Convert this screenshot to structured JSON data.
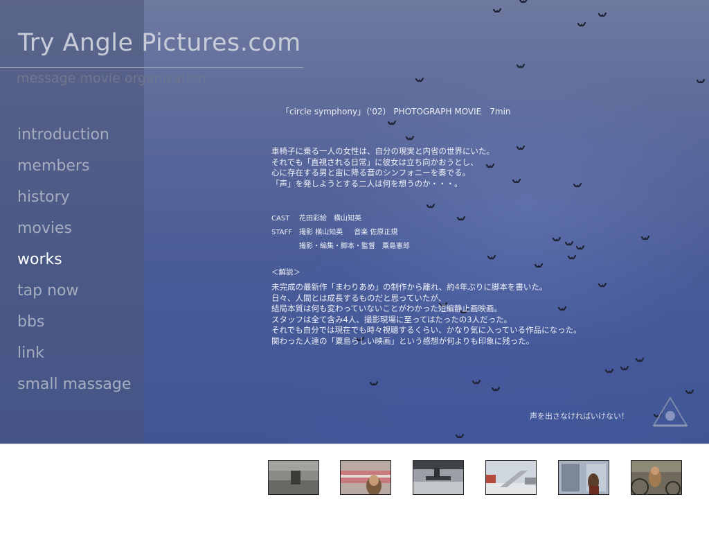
{
  "site": {
    "brand": "Try Angle Pictures.com",
    "tagline": "message movie organization"
  },
  "nav": {
    "items": [
      {
        "label": "introduction"
      },
      {
        "label": "members"
      },
      {
        "label": "history"
      },
      {
        "label": "movies"
      },
      {
        "label": "works",
        "active": true
      },
      {
        "label": "tap now"
      },
      {
        "label": "bbs"
      },
      {
        "label": "link"
      },
      {
        "label": "small massage"
      }
    ]
  },
  "work": {
    "title": "「circle symphony」（'02） PHOTOGRAPH MOVIE　7min",
    "synopsis": [
      "車椅子に乗る一人の女性は、自分の現実と内省の世界にいた。",
      "それでも「直視される日常」に彼女は立ち向かおうとし、",
      "心に存在する男と宙に降る音のシンフォニーを奏でる。",
      "「声」を発しようとする二人は何を想うのか・・・。"
    ],
    "credits": {
      "cast_label": "CAST",
      "cast": "花田彩絵　横山知英",
      "staff_label": "STAFF",
      "staff_1": "撮影 横山知英",
      "staff_2": "音楽 佐原正規",
      "staff_3": "撮影・編集・脚本・監督　粟島憲郎"
    },
    "note_heading": "＜解説＞",
    "notes": [
      "未完成の最新作「まわりあめ」の制作から離れ、約4年ぶりに脚本を書いた。",
      "日々、人間とは成長するものだと思っていたが、",
      "結局本質は何も変わっていないことがわかった短編静止画映画。",
      "スタッフは全て含み4人、撮影現場に至ってはたったの3人だった。",
      "それでも自分では現在でも時々視聴するくらい、かなり気に入っている作品になった。",
      "関わった人達の「粟島らしい映画」という感想が何よりも印象に残った。"
    ],
    "caption": "声を出さなければいけない！"
  },
  "thumbnails": [
    {
      "name": "thumb-street-wheelchair",
      "icon": "photo-thumbnail"
    },
    {
      "name": "thumb-woman-train",
      "icon": "photo-thumbnail"
    },
    {
      "name": "thumb-bench-park",
      "icon": "photo-thumbnail"
    },
    {
      "name": "thumb-stairs-plaza",
      "icon": "photo-thumbnail"
    },
    {
      "name": "thumb-woman-window",
      "icon": "photo-thumbnail"
    },
    {
      "name": "thumb-woman-bicycles",
      "icon": "photo-thumbnail"
    }
  ],
  "colors": {
    "sky": "#4a5c98",
    "sidebar": "#4b5578",
    "nav_active": "#ffffff",
    "nav_inactive": "#a6adc0"
  }
}
